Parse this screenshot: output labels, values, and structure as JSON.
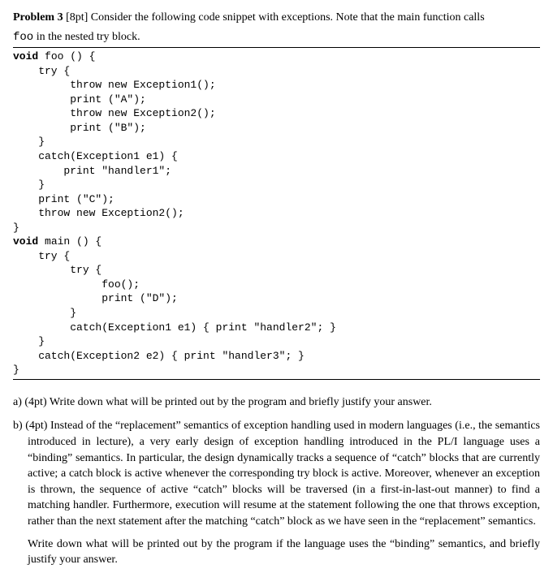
{
  "header": {
    "title": "Problem 3",
    "points": "[8pt]",
    "intro": "Consider the following code snippet with exceptions. Note that the main function calls",
    "intro_line2_prefix": "foo",
    "intro_line2_rest": " in the nested try block."
  },
  "code": {
    "kw_void1": "void",
    "line1_rest": " foo () {",
    "line2": "    try {",
    "line3": "         throw new Exception1();",
    "line4": "         print (\"A\");",
    "line5": "         throw new Exception2();",
    "line6": "         print (\"B\");",
    "line7": "    }",
    "line8": "    catch(Exception1 e1) {",
    "line9": "        print \"handler1\";",
    "line10": "    }",
    "line11": "    print (\"C\");",
    "line12": "    throw new Exception2();",
    "line13": "}",
    "kw_void2": "void",
    "line14_rest": " main () {",
    "line15": "    try {",
    "line16": "         try {",
    "line17": "              foo();",
    "line18": "              print (\"D\");",
    "line19": "         }",
    "line20": "         catch(Exception1 e1) { print \"handler2\"; }",
    "line21": "    }",
    "line22": "    catch(Exception2 e2) { print \"handler3\"; }",
    "line23": "}"
  },
  "questions": {
    "a": {
      "label": "a)",
      "points": "(4pt)",
      "text": "Write down what will be printed out by the program and briefly justify your answer."
    },
    "b": {
      "label": "b)",
      "points": "(4pt)",
      "text": "Instead of the “replacement” semantics of exception handling used in modern languages (i.e., the semantics introduced in lecture), a very early design of exception handling introduced in the PL/I language uses a “binding” semantics. In particular, the design dynamically tracks a sequence of “catch” blocks that are currently active; a catch block is active whenever the corresponding try block is active. Moreover, whenever an exception is thrown, the sequence of active “catch” blocks will be traversed (in a first-in-last-out manner) to find a matching handler. Furthermore, execution will resume at the statement following the one that throws exception, rather than the next statement after the matching “catch” block as we have seen in the “replacement” semantics.",
      "followup": "Write down what will be printed out by the program if the language uses the “binding” semantics, and briefly justify your answer."
    }
  }
}
